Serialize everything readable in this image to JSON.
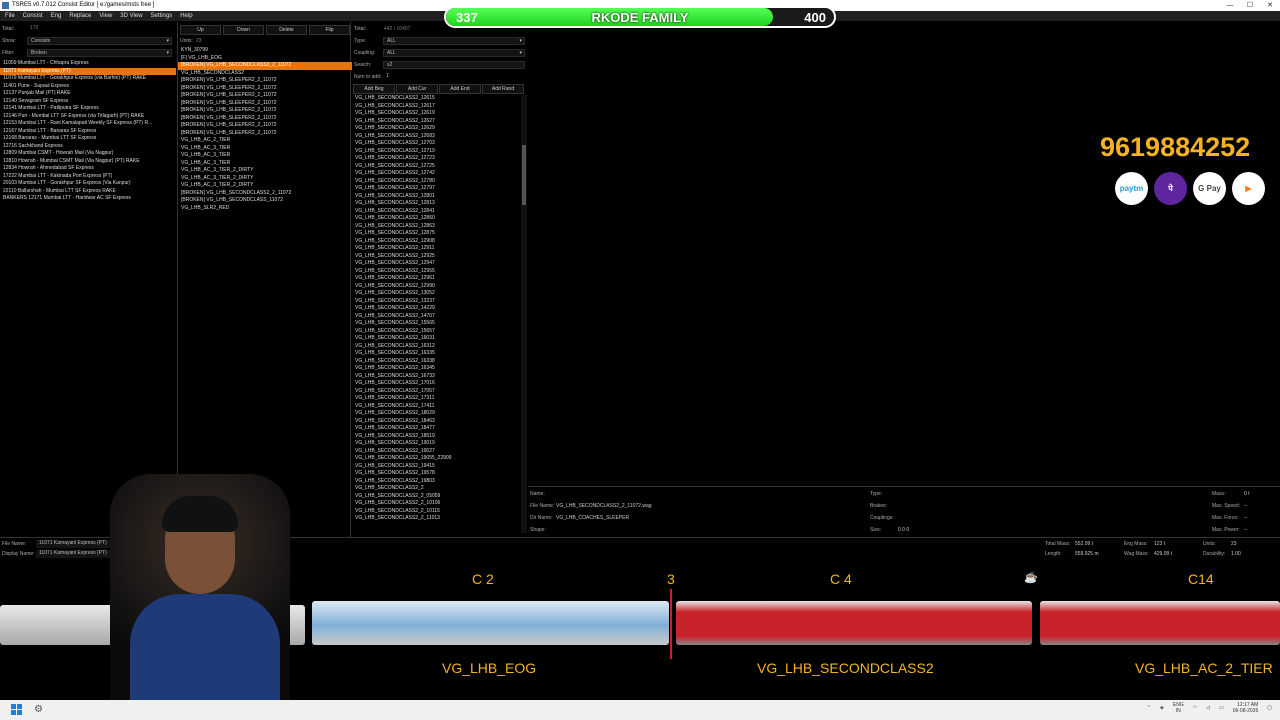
{
  "window": {
    "title": "TSRE5 v0.7.012 Consist Editor [ e:/games/msts free ]",
    "min": "—",
    "max": "☐",
    "close": "✕"
  },
  "menu": [
    "File",
    "Consist",
    "Eng",
    "Replace",
    "View",
    "3D View",
    "Settings",
    "Help"
  ],
  "banner": {
    "left": "337",
    "center": "RKODE FAMILY",
    "right": "400",
    "progress": 0.8425
  },
  "left": {
    "total_label": "Total:",
    "total_value": "170",
    "show_label": "Show:",
    "show_value": "Consists",
    "filter_label": "Filter:",
    "filter_value": "Broken",
    "items": [
      "11059 Mumbai LTT - Chhapra Express",
      "11071 Kamayani Express (PT)",
      "11079 Mumbai LTT - Gorakhpur Express (via Barhni) (PT) RAKE",
      "11401 Pune - Supaul Express",
      "12137 Punjab Mail (PT) RAKE",
      "12140 Sevagram SF Express",
      "12141 Mumbai LTT - Patliputra SF Express",
      "12146 Puri - Mumbai LTT SF Express (via Titlagarh) (PT) RAKE",
      "12153 Mumbai LTT - Rani Kamalapati Weekly SF Express (PT) R...",
      "12167 Mumbai LTT - Banaras SF Express",
      "12168 Banaras - Mumbai LTT SF Express",
      "12716 Sachkhand Express",
      "12809 Mumbai CSMT - Howrah Mail (Via Nagpur)",
      "12810 Howrah - Mumbai CSMT Mail (Via Nagpur) (PT) RAKE",
      "12834 Howrah - Ahmedabad SF Express",
      "17222 Mumbai LTT - Kakinada Port Express (PT)",
      "20103 Mumbai LTT - Gorakhpur SF Express (Via Kanpur)",
      "22110 Ballarshah - Mumbai LTT SF Express RAKE",
      "BANKERS 12171 Mumbai LTT - Haridwar AC SF Express"
    ],
    "selected_index": 1
  },
  "middle": {
    "buttons": [
      "Up",
      "Down",
      "Delete",
      "Flip"
    ],
    "units_label": "Units:",
    "units_value": "23",
    "items": [
      "KYN_30799",
      "[F] VG_LHB_EOG",
      "[BROKEN] VG_LHB_SECONDCLASS2_2_11072",
      "VG_LHB_SECONDCLASS2",
      "[BROKEN] VG_LHB_SLEEPER2_2_11072",
      "[BROKEN] VG_LHB_SLEEPER2_2_11072",
      "[BROKEN] VG_LHB_SLEEPER2_2_11072",
      "[BROKEN] VG_LHB_SLEEPER2_2_11072",
      "[BROKEN] VG_LHB_SLEEPER2_2_11072",
      "[BROKEN] VG_LHB_SLEEPER2_2_11072",
      "[BROKEN] VG_LHB_SLEEPER2_2_11072",
      "[BROKEN] VG_LHB_SLEEPER2_2_11072",
      "VG_LHB_AC_2_TIER",
      "VG_LHB_AC_3_TIER",
      "VG_LHB_AC_3_TIER",
      "VG_LHB_AC_3_TIER",
      "VG_LHB_AC_3_TIER_2_DIRTY",
      "VG_LHB_AC_3_TIER_2_DIRTY",
      "VG_LHB_AC_3_TIER_2_DIRTY",
      "[BROKEN] VG_LHB_SECONDCLASS2_2_11072",
      "[BROKEN] VG_LHB_SECONDCLASS_11072",
      "VG_LHB_SLR2_RED"
    ],
    "selected_index": 2
  },
  "right": {
    "total_label": "Total:",
    "total_value": "442 / 10407",
    "type_label": "Type:",
    "type_value": "ALL",
    "coupling_label": "Coupling:",
    "coupling_value": "ALL",
    "search_label": "Search:",
    "search_value": "s2",
    "num_label": "Num to add:",
    "num_value": "1",
    "buttons": [
      "Add Beg",
      "Add Cur",
      "Add End",
      "Add Rand"
    ],
    "items": [
      "VG_LHB_SECONDCLASS2_12615",
      "VG_LHB_SECONDCLASS2_12617",
      "VG_LHB_SECONDCLASS2_12619",
      "VG_LHB_SECONDCLASS2_12627",
      "VG_LHB_SECONDCLASS2_12629",
      "VG_LHB_SECONDCLASS2_12683",
      "VG_LHB_SECONDCLASS2_12703",
      "VG_LHB_SECONDCLASS2_12719",
      "VG_LHB_SECONDCLASS2_12723",
      "VG_LHB_SECONDCLASS2_12725",
      "VG_LHB_SECONDCLASS2_12742",
      "VG_LHB_SECONDCLASS2_12780",
      "VG_LHB_SECONDCLASS2_12797",
      "VG_LHB_SECONDCLASS2_12801",
      "VG_LHB_SECONDCLASS2_12813",
      "VG_LHB_SECONDCLASS2_12841",
      "VG_LHB_SECONDCLASS2_12860",
      "VG_LHB_SECONDCLASS2_12863",
      "VG_LHB_SECONDCLASS2_12875",
      "VG_LHB_SECONDCLASS2_12908",
      "VG_LHB_SECONDCLASS2_12911",
      "VG_LHB_SECONDCLASS2_12925",
      "VG_LHB_SECONDCLASS2_12947",
      "VG_LHB_SECONDCLASS2_12955",
      "VG_LHB_SECONDCLASS2_12961",
      "VG_LHB_SECONDCLASS2_12990",
      "VG_LHB_SECONDCLASS2_13052",
      "VG_LHB_SECONDCLASS2_13237",
      "VG_LHB_SECONDCLASS2_14229",
      "VG_LHB_SECONDCLASS2_14707",
      "VG_LHB_SECONDCLASS2_15565",
      "VG_LHB_SECONDCLASS2_15657",
      "VG_LHB_SECONDCLASS2_16031",
      "VG_LHB_SECONDCLASS2_16312",
      "VG_LHB_SECONDCLASS2_16335",
      "VG_LHB_SECONDCLASS2_16338",
      "VG_LHB_SECONDCLASS2_16345",
      "VG_LHB_SECONDCLASS2_16733",
      "VG_LHB_SECONDCLASS2_17016",
      "VG_LHB_SECONDCLASS2_17057",
      "VG_LHB_SECONDCLASS2_17311",
      "VG_LHB_SECONDCLASS2_17411",
      "VG_LHB_SECONDCLASS2_18029",
      "VG_LHB_SECONDCLASS2_18463",
      "VG_LHB_SECONDCLASS2_18477",
      "VG_LHB_SECONDCLASS2_18519",
      "VG_LHB_SECONDCLASS2_19019",
      "VG_LHB_SECONDCLASS2_19027",
      "VG_LHB_SECONDCLASS2_19055_22909",
      "VG_LHB_SECONDCLASS2_19415",
      "VG_LHB_SECONDCLASS2_19578",
      "VG_LHB_SECONDCLASS2_19803",
      "VG_LHB_SECONDCLASS2_2",
      "VG_LHB_SECONDCLASS2_2_05059",
      "VG_LHB_SECONDCLASS2_2_10106",
      "VG_LHB_SECONDCLASS2_2_10115",
      "VG_LHB_SECONDCLASS2_2_11013"
    ]
  },
  "overlay": {
    "phone": "9619884252",
    "pay_icons": [
      {
        "name": "paytm-icon",
        "label": "paytm",
        "bg": "#ffffff",
        "fg": "#1b9ed8"
      },
      {
        "name": "phonepe-icon",
        "label": "पे",
        "bg": "#5f259f",
        "fg": "#ffffff"
      },
      {
        "name": "gpay-icon",
        "label": "G Pay",
        "bg": "#ffffff",
        "fg": "#444444"
      },
      {
        "name": "bhim-icon",
        "label": "▶",
        "bg": "#ffffff",
        "fg": "#f47b20"
      }
    ]
  },
  "info": {
    "name_label": "Name:",
    "name_value": "",
    "file_label": "File Name:",
    "file_value": "VG_LHB_SECONDCLASS2_2_11072.wag",
    "dir_label": "Dir Name:",
    "dir_value": "VG_LHB_COACHES_SLEEPER",
    "shape_label": "Shape:",
    "shape_value": "",
    "type_label": "Type:",
    "type_value": "",
    "brakes_label": "Brakes:",
    "brakes_value": "",
    "couplings_label": "Couplings:",
    "couplings_value": "",
    "size_label": "Size:",
    "size_value": "0 0 0",
    "mass_label": "Mass:",
    "mass_value": "0 t",
    "maxspeed_label": "Max. Speed:",
    "maxspeed_value": "--",
    "maxforce_label": "Max. Force:",
    "maxforce_value": "--",
    "maxpower_label": "Max. Power:",
    "maxpower_value": "--"
  },
  "bottom": {
    "file_label": "File Name:",
    "file_value": "11071 Kamayani Express (PT)",
    "display_label": "Display Name:",
    "display_value": "11071 Kamayani Express (PT)",
    "total_mass_label": "Total Mass:",
    "total_mass_value": "552.09 t",
    "eng_mass_label": "Eng Mass:",
    "eng_mass_value": "123 t",
    "units_label": "Units:",
    "units_value": "23",
    "length_label": "Length:",
    "length_value": "559.925 m",
    "wag_mass_label": "Wag Mass:",
    "wag_mass_value": "429.09 t",
    "durability_label": "Durability:",
    "durability_value": "1.00"
  },
  "strip": {
    "top_labels": [
      "C 2",
      "3",
      "C 4",
      "C14"
    ],
    "bottom_labels": [
      "VG_LHB_EOG",
      "VG_LHB_SECONDCLASS2",
      "VG_LHB_AC_2_TIER"
    ],
    "colors": {
      "accent": "#f5b324",
      "coach_red": "#c8232a",
      "coach_blue": "#7fb0d8"
    }
  },
  "taskbar": {
    "lang": "ENG",
    "region": "IN",
    "time": "12:17 AM",
    "date": "06-08-2026"
  }
}
